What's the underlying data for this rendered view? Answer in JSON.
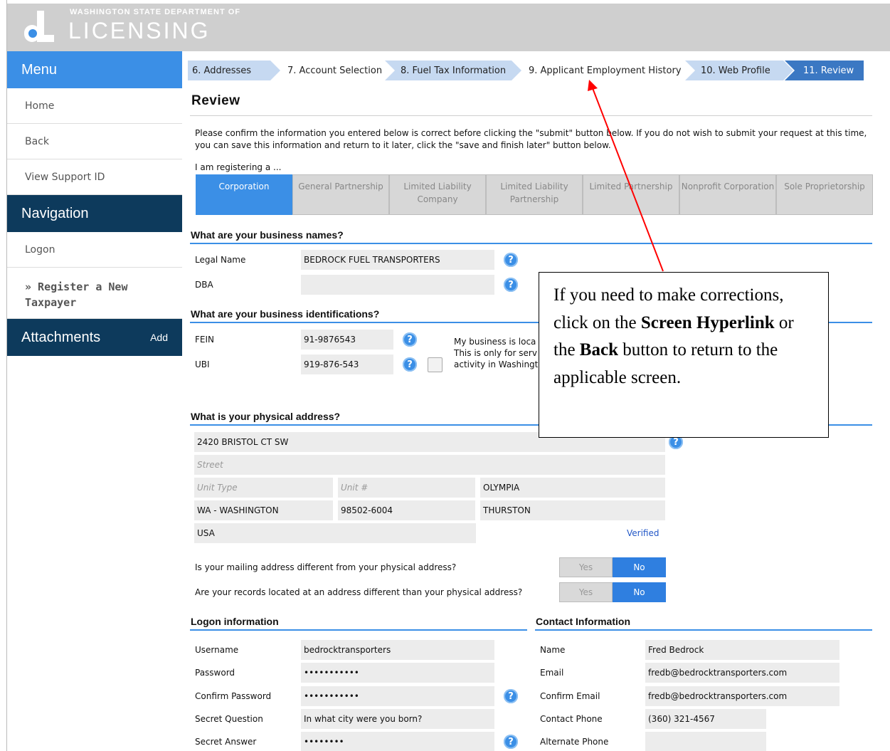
{
  "header": {
    "logo_top": "WASHINGTON STATE DEPARTMENT OF",
    "logo_main": "LICENSING"
  },
  "sidebar": {
    "menu_title": "Menu",
    "menu_items": [
      "Home",
      "Back",
      "View Support ID"
    ],
    "navigation_title": "Navigation",
    "nav_items": [
      "Logon",
      "» Register a New Taxpayer"
    ],
    "attachments_title": "Attachments",
    "attachments_add": "Add"
  },
  "steps": [
    "6. Addresses",
    "7. Account Selection",
    "8. Fuel Tax Information",
    "9. Applicant Employment History",
    "10. Web Profile",
    "11. Review"
  ],
  "review": {
    "title": "Review",
    "intro": "Please confirm the information you entered below is correct before clicking the \"submit\" button below. If you do not wish to submit your request at this time, you can save this information and return to it later, click the \"save and finish later\" button below.",
    "registering_label": "I am registering a ...",
    "entity_types": [
      "Corporation",
      "General Partnership",
      "Limited Liability Company",
      "Limited Liability Partnership",
      "Limited Partnership",
      "Nonprofit Corporation",
      "Sole Proprietorship"
    ],
    "entity_selected": "Corporation"
  },
  "business_names": {
    "title": "What are your business names?",
    "legal_label": "Legal Name",
    "legal_value": "BEDROCK FUEL TRANSPORTERS",
    "dba_label": "DBA",
    "dba_value": ""
  },
  "identifications": {
    "title": "What are your business identifications?",
    "fein_label": "FEIN",
    "fein_value": "91-9876543",
    "ubi_label": "UBI",
    "ubi_value": "919-876-543",
    "checkbox_text": [
      "My business is loca",
      "This is only for serv",
      "activity in Washingt"
    ]
  },
  "physical_address": {
    "title": "What is your physical address?",
    "line1": "2420 BRISTOL CT SW",
    "street_ph": "Street",
    "unit_type_ph": "Unit Type",
    "unit_ph": "Unit #",
    "city": "OLYMPIA",
    "state": "WA - WASHINGTON",
    "zip": "98502-6004",
    "county": "THURSTON",
    "country": "USA",
    "verified": "Verified",
    "mailing_q": "Is your mailing address different from your physical address?",
    "records_q": "Are your records located at an address different than your physical address?",
    "yes": "Yes",
    "no": "No"
  },
  "logon": {
    "title": "Logon information",
    "username_label": "Username",
    "username_value": "bedrocktransporters",
    "password_label": "Password",
    "password_value": "•••••••••••",
    "confirm_label": "Confirm Password",
    "confirm_value": "•••••••••••",
    "question_label": "Secret Question",
    "question_value": "In what city were you born?",
    "answer_label": "Secret Answer",
    "answer_value": "••••••••"
  },
  "contact": {
    "title": "Contact Information",
    "name_label": "Name",
    "name_value": "Fred Bedrock",
    "email_label": "Email",
    "email_value": "fredb@bedrocktransporters.com",
    "confirm_label": "Confirm Email",
    "confirm_value": "fredb@bedrocktransporters.com",
    "phone_label": "Contact Phone",
    "phone_value": "(360) 321-4567",
    "alt_label": "Alternate Phone",
    "alt_value": ""
  },
  "callout": {
    "p1": "If you need to make corrections, click on the",
    "b1": "Screen Hyperlink",
    "p2": "or the",
    "b2": "Back",
    "p3": "button to return to the applicable screen."
  },
  "icons": {
    "help": "?"
  },
  "colors": {
    "accent": "#3b8fe6",
    "nav_dark": "#0d3a5c",
    "step_bg": "#c6d9f1",
    "arrow": "#ff0000"
  }
}
